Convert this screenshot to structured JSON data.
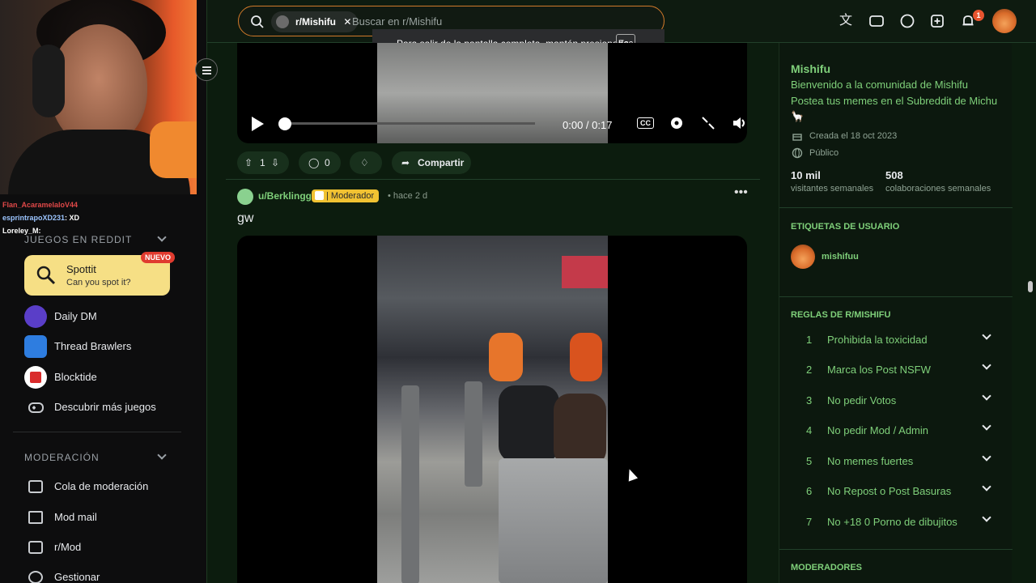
{
  "topbar": {
    "community_chip": "r/Mishifu",
    "search_placeholder": "Buscar en r/Mishifu",
    "notification_count": "1"
  },
  "toast": {
    "text": "Para salir de la pantalla completa, mantén presionado",
    "key": "Esc"
  },
  "stream": {
    "chat": [
      {
        "user": "Flan_AcaramelaloV44",
        "msg": "",
        "user_color": "#e04848"
      },
      {
        "user": "esprintrapoXD231",
        "msg": ": XD",
        "user_color": "#9cc5ff"
      },
      {
        "user": "Loreley_M",
        "msg": ":",
        "user_color": "#ffffff"
      }
    ]
  },
  "sidebar": {
    "games_header": "JUEGOS EN REDDIT",
    "spottit": {
      "title": "Spottit",
      "subtitle": "Can you spot it?",
      "badge": "NUEVO"
    },
    "games": [
      {
        "label": "Daily DM",
        "icon": "daily-dm-icon"
      },
      {
        "label": "Thread Brawlers",
        "icon": "thread-brawlers-icon"
      },
      {
        "label": "Blocktide",
        "icon": "blocktide-icon"
      },
      {
        "label": "Descubrir más juegos",
        "icon": "gamepad-icon"
      }
    ],
    "mod_header": "MODERACIÓN",
    "mod_items": [
      {
        "label": "Cola de moderación",
        "icon": "queue-icon"
      },
      {
        "label": "Mod mail",
        "icon": "mail-icon"
      },
      {
        "label": "r/Mod",
        "icon": "queue-icon"
      },
      {
        "label": "Gestionar",
        "icon": "gear-icon"
      }
    ]
  },
  "post1": {
    "time": "0:00 / 0:17",
    "progress": 0.0,
    "votes": "1",
    "comments": "0",
    "share": "Compartir"
  },
  "post2": {
    "author": "u/Berklingg",
    "flair": "| Moderador",
    "time": "• hace 2 d",
    "title": "gw"
  },
  "community": {
    "name": "Mishifu",
    "desc1": "Bienvenido a la comunidad de Mishifu",
    "desc2": "Postea tus memes en el Subreddit de Michu",
    "created": "Creada el 18 oct 2023",
    "visibility": "Público",
    "stats": [
      {
        "value": "10 mil",
        "label": "visitantes semanales"
      },
      {
        "value": "508",
        "label": "colaboraciones semanales"
      }
    ],
    "user_tags_header": "ETIQUETAS DE USUARIO",
    "user_tag": "mishifuu",
    "rules_header": "REGLAS DE R/MISHIFU",
    "rules": [
      {
        "num": "1",
        "label": "Prohibida la toxicidad"
      },
      {
        "num": "2",
        "label": "Marca los Post NSFW"
      },
      {
        "num": "3",
        "label": "No pedir Votos"
      },
      {
        "num": "4",
        "label": "No pedir Mod / Admin"
      },
      {
        "num": "5",
        "label": "No memes fuertes"
      },
      {
        "num": "6",
        "label": "No Repost o Post Basuras"
      },
      {
        "num": "7",
        "label": "No +18 0 Porno de dibujitos"
      }
    ],
    "moderators_header": "MODERADORES"
  },
  "colors": {
    "accent_green": "#7fd07a",
    "flair_yellow": "#f1c232",
    "search_border": "#d17a2a"
  }
}
